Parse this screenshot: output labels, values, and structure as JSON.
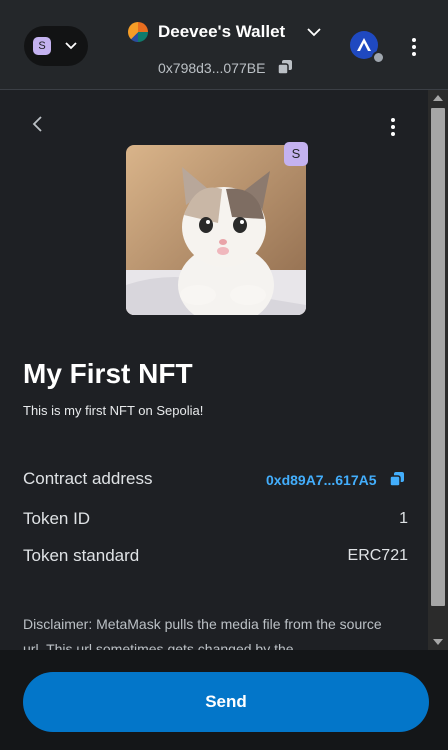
{
  "header": {
    "network_badge_letter": "S",
    "account_name": "Deevee's Wallet",
    "account_address": "0x798d3...077BE"
  },
  "nft": {
    "badge_letter": "S",
    "title": "My First NFT",
    "description": "This is my first NFT on Sepolia!",
    "image_icon": "cat-photo"
  },
  "details": {
    "contract_label": "Contract address",
    "contract_value": "0xd89A7...617A5",
    "token_id_label": "Token ID",
    "token_id_value": "1",
    "standard_label": "Token standard",
    "standard_value": "ERC721"
  },
  "disclaimer": "Disclaimer: MetaMask pulls the media file from the source url. This url sometimes gets changed by the",
  "footer": {
    "send_label": "Send"
  },
  "colors": {
    "accent": "#0376c9",
    "link": "#43aefc",
    "network_badge": "#c4b2f0"
  }
}
